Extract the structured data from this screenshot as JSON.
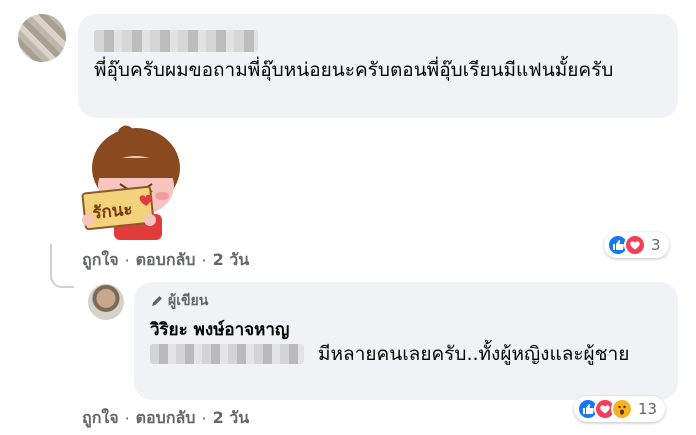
{
  "comment": {
    "text": "พี่อุ๊บครับผมขอถามพี่อุ๊บหน่อยนะครับตอนพี่อุ๊บเรียนมีแฟนมั้ยครับ",
    "sticker_text": "รักนะ",
    "like_label": "ถูกใจ",
    "reply_label": "ตอบกลับ",
    "separator": "·",
    "time": "2 วัน",
    "reaction_count": "3",
    "reaction_icons": [
      "like-icon",
      "love-icon"
    ]
  },
  "reply": {
    "author_badge": "ผู้เขียน",
    "author_name": "วิริยะ พงษ์อาจหาญ",
    "text": "มีหลายคนเลยครับ..ทั้งผู้หญิงและผู้ชาย",
    "like_label": "ถูกใจ",
    "reply_label": "ตอบกลับ",
    "separator": "·",
    "time": "2 วัน",
    "reaction_count": "13",
    "reaction_icons": [
      "like-icon",
      "love-icon",
      "wow-icon"
    ]
  },
  "colors": {
    "bubble": "#f0f2f5",
    "secondary_text": "#65676b",
    "like": "#1877f2",
    "love": "#f33e58",
    "wow": "#f7b125"
  }
}
